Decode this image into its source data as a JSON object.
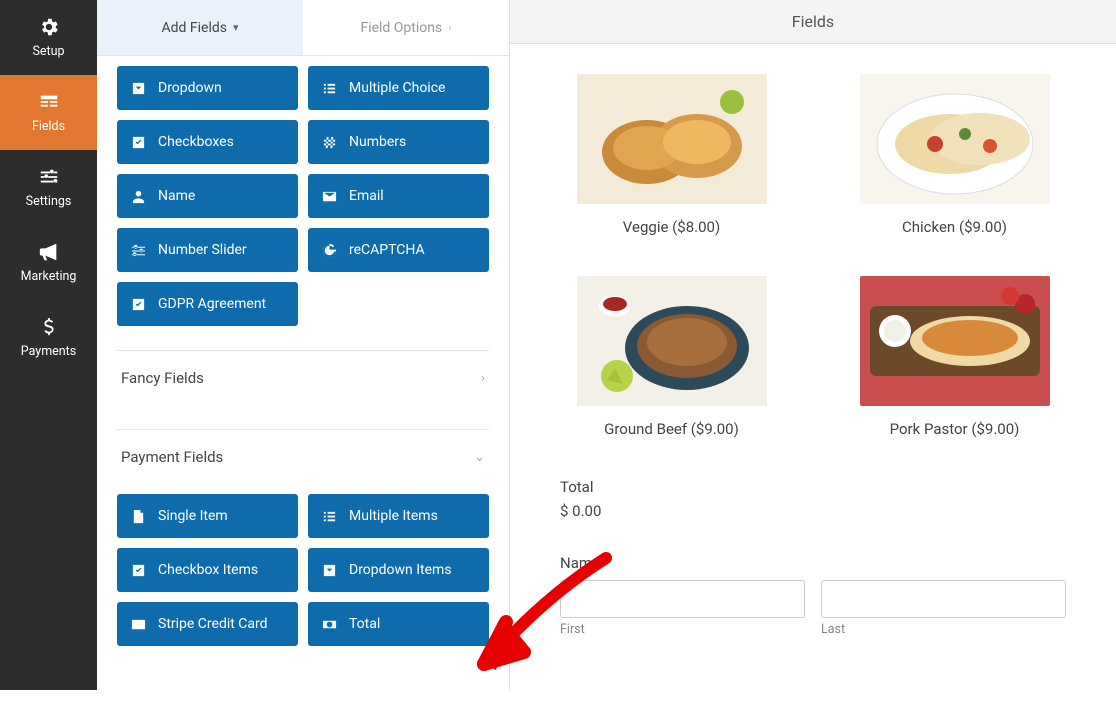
{
  "rail": {
    "items": [
      {
        "id": "setup",
        "label": "Setup"
      },
      {
        "id": "fields",
        "label": "Fields"
      },
      {
        "id": "settings",
        "label": "Settings"
      },
      {
        "id": "marketing",
        "label": "Marketing"
      },
      {
        "id": "payments",
        "label": "Payments"
      }
    ]
  },
  "panel": {
    "tabs": {
      "add_fields": "Add Fields",
      "field_options": "Field Options"
    },
    "standard_fields": [
      {
        "id": "dropdown",
        "label": "Dropdown",
        "icon": "chevron-down-box"
      },
      {
        "id": "multiple-choice",
        "label": "Multiple Choice",
        "icon": "list"
      },
      {
        "id": "checkboxes",
        "label": "Checkboxes",
        "icon": "check-square"
      },
      {
        "id": "numbers",
        "label": "Numbers",
        "icon": "hash"
      },
      {
        "id": "name",
        "label": "Name",
        "icon": "user"
      },
      {
        "id": "email",
        "label": "Email",
        "icon": "envelope"
      },
      {
        "id": "number-slider",
        "label": "Number Slider",
        "icon": "sliders"
      },
      {
        "id": "recaptcha",
        "label": "reCAPTCHA",
        "icon": "google-g"
      },
      {
        "id": "gdpr",
        "label": "GDPR Agreement",
        "icon": "check-square"
      }
    ],
    "sections": {
      "fancy": "Fancy Fields",
      "payment": "Payment Fields"
    },
    "payment_fields": [
      {
        "id": "single-item",
        "label": "Single Item",
        "icon": "file"
      },
      {
        "id": "multiple-items",
        "label": "Multiple Items",
        "icon": "list"
      },
      {
        "id": "checkbox-items",
        "label": "Checkbox Items",
        "icon": "check-square"
      },
      {
        "id": "dropdown-items",
        "label": "Dropdown Items",
        "icon": "chevron-down-box"
      },
      {
        "id": "stripe",
        "label": "Stripe Credit Card",
        "icon": "credit-card"
      },
      {
        "id": "total",
        "label": "Total",
        "icon": "money"
      }
    ]
  },
  "preview": {
    "header": "Fields",
    "menu": [
      {
        "id": "veggie",
        "label": "Veggie ($8.00)"
      },
      {
        "id": "chicken",
        "label": "Chicken ($9.00)"
      },
      {
        "id": "ground-beef",
        "label": "Ground Beef ($9.00)"
      },
      {
        "id": "pork-pastor",
        "label": "Pork Pastor ($9.00)"
      }
    ],
    "total": {
      "label": "Total",
      "value": "$ 0.00"
    },
    "name": {
      "label": "Name",
      "required_mark": "*",
      "first_label": "First",
      "last_label": "Last"
    }
  }
}
